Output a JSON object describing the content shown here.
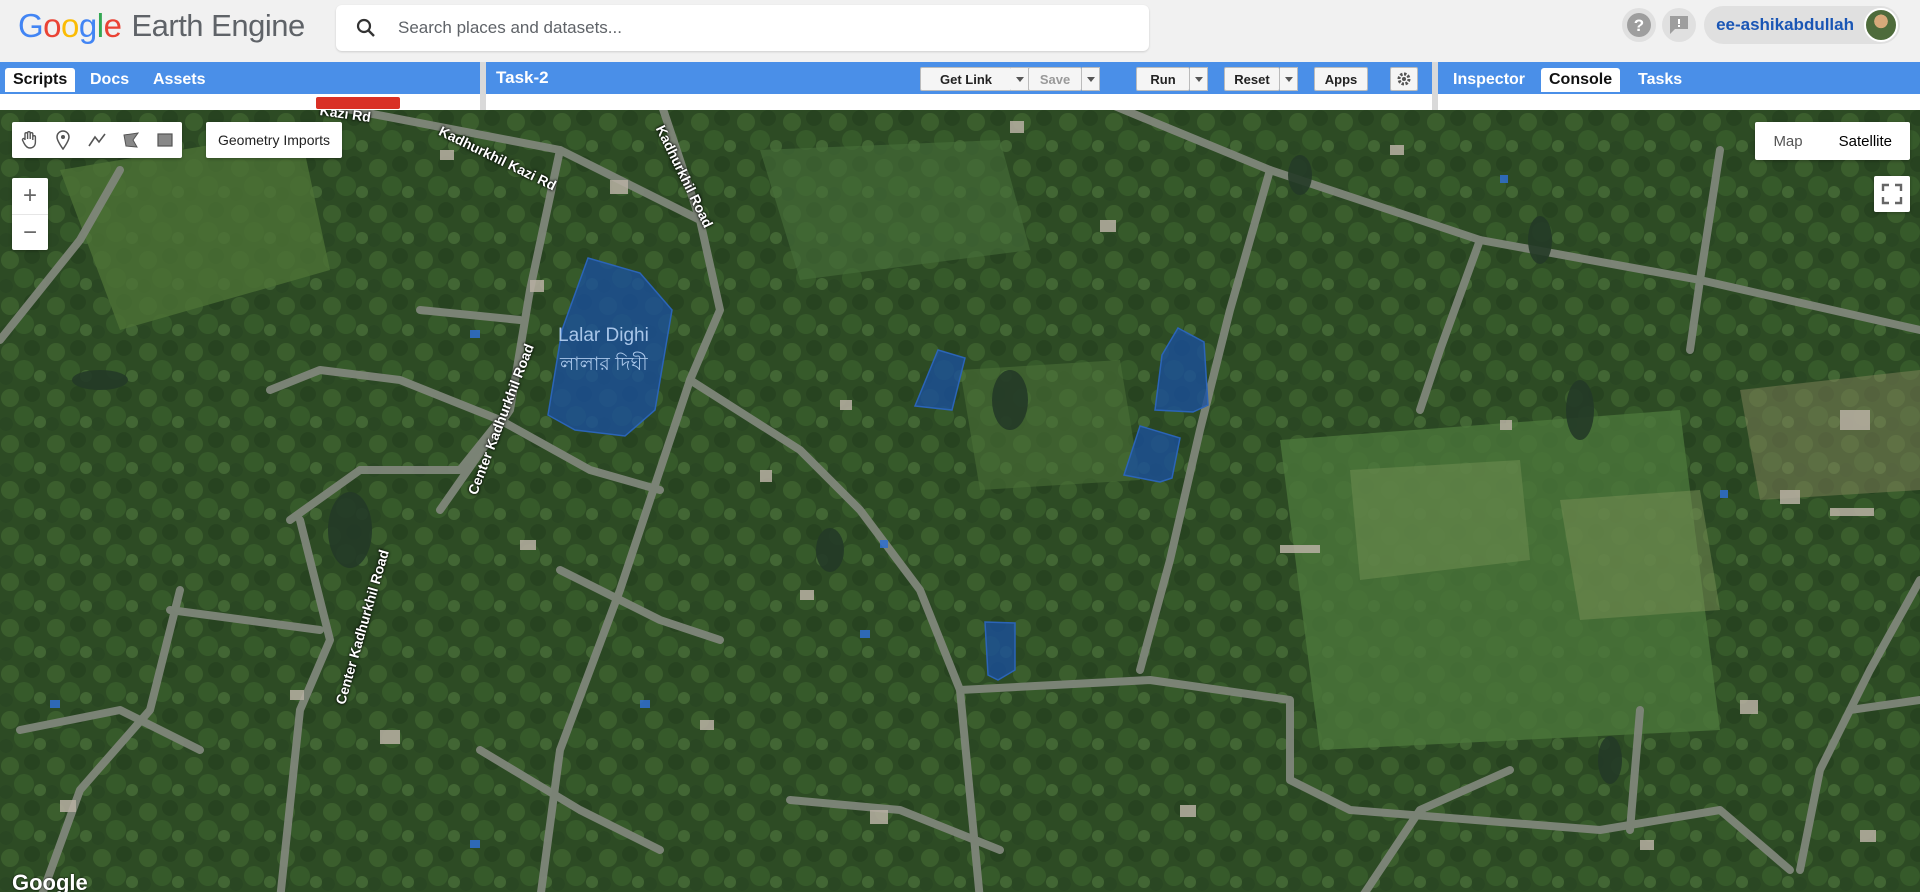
{
  "header": {
    "logo_letters": [
      "G",
      "o",
      "o",
      "g",
      "l",
      "e"
    ],
    "product": "Earth Engine",
    "search_placeholder": "Search places and datasets...",
    "user": "ee-ashikabdullah"
  },
  "left_panel": {
    "tabs": [
      "Scripts",
      "Docs",
      "Assets"
    ],
    "active_tab": "Scripts"
  },
  "editor": {
    "title": "Task-2",
    "buttons": {
      "get_link": "Get Link",
      "save": "Save",
      "run": "Run",
      "reset": "Reset",
      "apps": "Apps"
    }
  },
  "right_panel": {
    "tabs": [
      "Inspector",
      "Console",
      "Tasks"
    ],
    "active_tab": "Console"
  },
  "map": {
    "geometry_imports_label": "Geometry Imports",
    "zoom_in": "+",
    "zoom_out": "−",
    "map_type_options": [
      "Map",
      "Satellite"
    ],
    "map_type_selected": "Satellite",
    "road_labels": [
      "Kadhurkhil Kazi Rd",
      "Kadhurkhil Road",
      "Center Kadhurkhil Road",
      "Center Kadhurkhil Road",
      "Kazi Rd"
    ],
    "place_label_en": "Lalar Dighi",
    "place_label_bn": "লালার দিঘী",
    "attribution": "Google",
    "polygon_color": "#1a4f9c"
  },
  "colors": {
    "toolbar_blue": "#4a8fe8",
    "header_bg": "#f1f1f1",
    "link_blue": "#1a56b5"
  }
}
